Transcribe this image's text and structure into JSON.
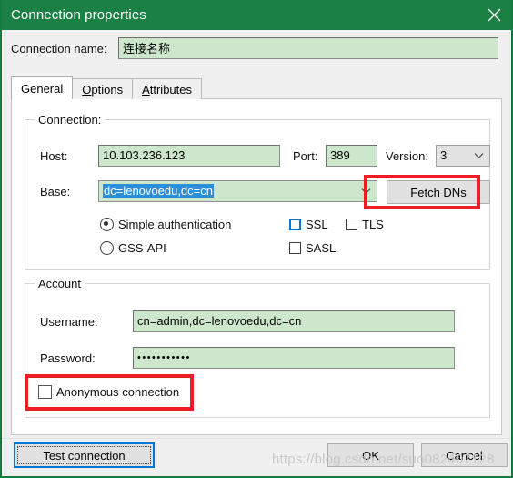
{
  "window": {
    "title": "Connection properties",
    "close_icon": "close-icon",
    "titlebar_color": "#1a8043",
    "border_color": "#157a3f"
  },
  "connection_name": {
    "label": "Connection name:",
    "value": "连接名称"
  },
  "tabs": [
    {
      "label": "General",
      "active": true
    },
    {
      "label": "Options",
      "mnemonic": "O",
      "active": false
    },
    {
      "label": "Attributes",
      "mnemonic": "A",
      "active": false
    }
  ],
  "connection_group": {
    "title": "Connection:",
    "host": {
      "label": "Host:",
      "value": "10.103.236.123"
    },
    "port": {
      "label": "Port:",
      "value": "389"
    },
    "version": {
      "label": "Version:",
      "value": "3"
    },
    "base": {
      "label": "Base:",
      "value": "dc=lenovoedu,dc=cn",
      "selected": true
    },
    "fetch_dns_button": "Fetch DNs",
    "auth_options": [
      {
        "label": "Simple authentication",
        "checked": true
      },
      {
        "label": "GSS-API",
        "checked": false
      }
    ],
    "security_options": [
      {
        "label": "SSL",
        "checked": false,
        "focused": true
      },
      {
        "label": "TLS",
        "checked": false,
        "focused": false
      },
      {
        "label": "SASL",
        "checked": false,
        "focused": false
      }
    ]
  },
  "account_group": {
    "title": "Account",
    "username": {
      "label": "Username:",
      "value": "cn=admin,dc=lenovoedu,dc=cn"
    },
    "password": {
      "label": "Password:",
      "value": "•••••••••••"
    },
    "anonymous": {
      "label": "Anonymous connection",
      "checked": false
    }
  },
  "footer": {
    "test_connection": "Test connection",
    "ok": "OK",
    "cancel": "Cancel"
  },
  "watermark": "https://blog.csdn.net/suo082407128"
}
